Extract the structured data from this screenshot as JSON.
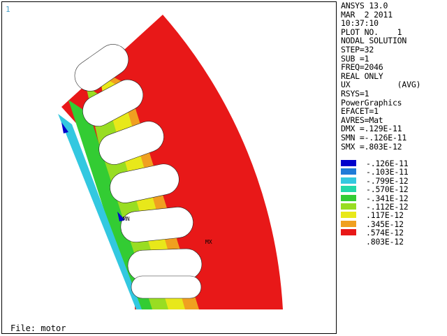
{
  "window": {
    "number": "1",
    "file_label": "File: motor"
  },
  "info": [
    "ANSYS 13.0",
    "MAR  2 2011",
    "10:37:10",
    "PLOT NO.    1",
    "NODAL SOLUTION",
    "STEP=32",
    "SUB =1",
    "FREQ=2046",
    "REAL ONLY",
    "UX          (AVG)",
    "RSYS=1",
    "PowerGraphics",
    "EFACET=1",
    "AVRES=Mat",
    "DMX =.129E-11",
    "SMN =-.126E-11",
    "SMX =.803E-12"
  ],
  "legend": [
    {
      "value": "-.126E-11",
      "color": "#0000cc"
    },
    {
      "value": "-.103E-11",
      "color": "#1f7bd8"
    },
    {
      "value": "-.799E-12",
      "color": "#33c8e0"
    },
    {
      "value": "-.570E-12",
      "color": "#22d8a8"
    },
    {
      "value": "-.341E-12",
      "color": "#33cc33"
    },
    {
      "value": "-.112E-12",
      "color": "#99dd22"
    },
    {
      "value": ".117E-12",
      "color": "#e8e81a"
    },
    {
      "value": ".345E-12",
      "color": "#f0a020"
    },
    {
      "value": ".574E-12",
      "color": "#e81818"
    },
    {
      "value": ".803E-12",
      "color": ""
    }
  ],
  "markers": {
    "min_label": "MN",
    "max_label": "MX"
  },
  "colors": {
    "red": "#e81818",
    "orange": "#f0a020",
    "yellow": "#e8e81a",
    "ygreen": "#99dd22",
    "green": "#33cc33",
    "cyan": "#33c8e0",
    "blue": "#0000cc"
  }
}
